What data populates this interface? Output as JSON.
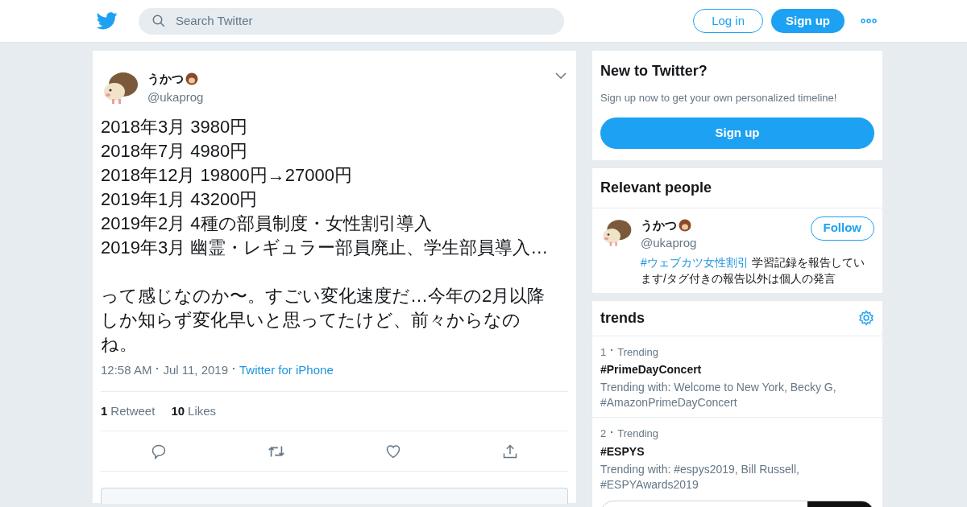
{
  "header": {
    "search": {
      "placeholder": "Search Twitter"
    },
    "login": "Log in",
    "signup": "Sign up"
  },
  "tweet": {
    "name": "うかつ",
    "handle": "@ukaprog",
    "text": "2018年3月 3980円\n2018年7月 4980円\n2018年12月 19800円→27000円\n2019年1月 43200円\n2019年2月 4種の部員制度・女性割引導入\n2019年3月 幽霊・レギュラー部員廃止、学生部員導入…\n\nって感じなのか〜。すごい変化速度だ…今年の2月以降しか知らず変化早いと思ってたけど、前々からなのね。",
    "time": "12:58 AM",
    "date": "Jul 11, 2019",
    "source": "Twitter for iPhone",
    "stats": [
      {
        "count": "1",
        "label": "Retweet"
      },
      {
        "count": "10",
        "label": "Likes"
      }
    ]
  },
  "signup_card": {
    "title": "New to Twitter?",
    "text": "Sign up now to get your own personalized timeline!",
    "button": "Sign up"
  },
  "people": {
    "title": "Relevant people",
    "name": "うかつ",
    "handle": "@ukaprog",
    "follow": "Follow",
    "bio_tag": "#ウェブカツ女性割引",
    "bio": "学習記録を報告しています/タグ付きの報告以外は個人の発言"
  },
  "trends": {
    "title": "trends",
    "items": [
      {
        "rank": "1",
        "meta": "Trending",
        "name": "#PrimeDayConcert",
        "with": "Trending with: Welcome to New York, Becky G, #AmazonPrimeDayConcert"
      },
      {
        "rank": "2",
        "meta": "Trending",
        "name": "#ESPYS",
        "with": "Trending with: #espys2019, Bill Russell, #ESPYAwards2019"
      }
    ]
  }
}
